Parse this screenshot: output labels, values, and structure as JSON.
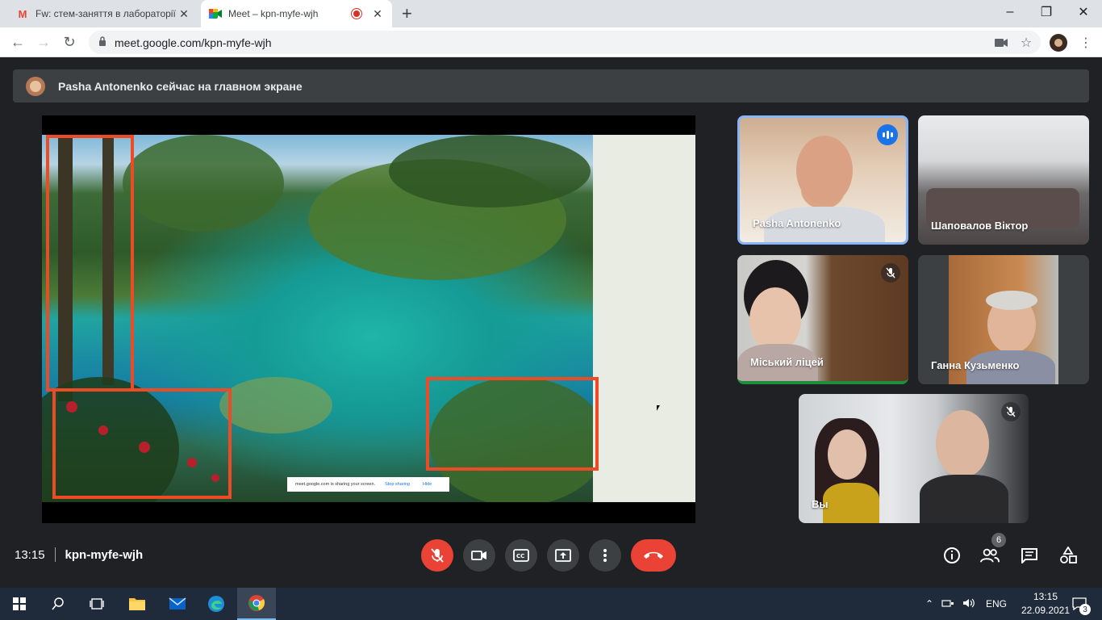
{
  "browser": {
    "tabs": [
      {
        "title": "Fw: стем-заняття в лабораторії"
      },
      {
        "title": "Meet – kpn-myfe-wjh"
      }
    ],
    "address": "meet.google.com/kpn-myfe-wjh"
  },
  "banner": {
    "text": "Pasha Antonenko сейчас на главном экране"
  },
  "presentation": {
    "share_notice": "meet.google.com is sharing your screen.",
    "stop_label": "Stop sharing",
    "hide_label": "Hide"
  },
  "participants": [
    {
      "name": "Pasha Antonenko",
      "state": "speaking"
    },
    {
      "name": "Шаповалов Віктор"
    },
    {
      "name": "Міський ліцей",
      "state": "muted"
    },
    {
      "name": "Ганна Кузьменко"
    },
    {
      "name": "Вы",
      "state": "muted"
    }
  ],
  "meeting": {
    "time": "13:15",
    "code": "kpn-myfe-wjh",
    "participant_count": "6"
  },
  "colors": {
    "accent": "#1a73e8",
    "end_call": "#ea4335",
    "highlight": "#ef4a26",
    "speaking_border": "#8ab4f8"
  },
  "taskbar": {
    "language": "ENG",
    "time": "13:15",
    "date": "22.09.2021",
    "notifications": "3"
  }
}
